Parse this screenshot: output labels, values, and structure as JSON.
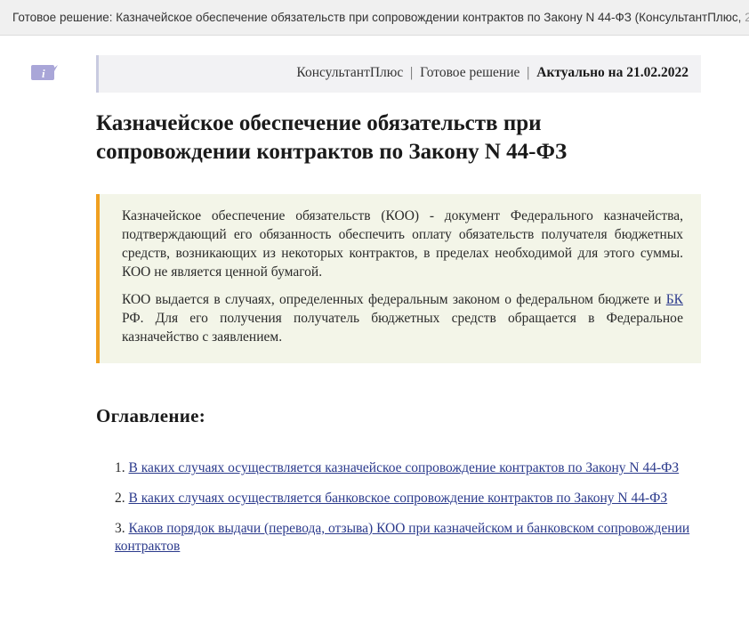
{
  "window": {
    "title": "Готовое решение: Казначейское обеспечение обязательств при сопровождении контрактов по Закону N 44-ФЗ (КонсультантПлюс,",
    "title_fade": " 2"
  },
  "header": {
    "source": "КонсультантПлюс",
    "doc_type": "Готовое решение",
    "separator": "|",
    "actual": "Актуально на 21.02.2022"
  },
  "document": {
    "title": "Казначейское обеспечение обязательств при сопровождении контрактов по Закону N 44-ФЗ"
  },
  "note": {
    "p1": "Казначейское обеспечение обязательств (КОО) - документ Федерального казначейства, подтверждающий его обязанность обеспечить оплату обязательств получателя бюджетных средств, возникающих из некоторых контрактов, в пределах необходимой для этого суммы. КОО не является ценной бумагой.",
    "p2_before": "КОО выдается в случаях, определенных федеральным законом о федеральном бюджете и ",
    "p2_link": "БК",
    "p2_after": " РФ. Для его получения получатель бюджетных средств обращается в Федеральное казначейство с заявлением."
  },
  "toc": {
    "heading": "Оглавление:",
    "items": [
      {
        "num": "1.",
        "label": "В каких случаях осуществляется казначейское сопровождение контрактов по Закону N 44-ФЗ"
      },
      {
        "num": "2.",
        "label": "В каких случаях осуществляется банковское сопровождение контрактов по Закону N 44-ФЗ"
      },
      {
        "num": "3.",
        "label": "Каков порядок выдачи (перевода, отзыва) КОО при казначейском и банковском сопровождении контрактов"
      }
    ]
  },
  "colors": {
    "accent_bar": "#f0a020",
    "note_bg": "#f3f5e8",
    "link": "#2b3a8c",
    "info_icon": "#a9a6d8"
  },
  "icons": {
    "info": "info-icon"
  }
}
